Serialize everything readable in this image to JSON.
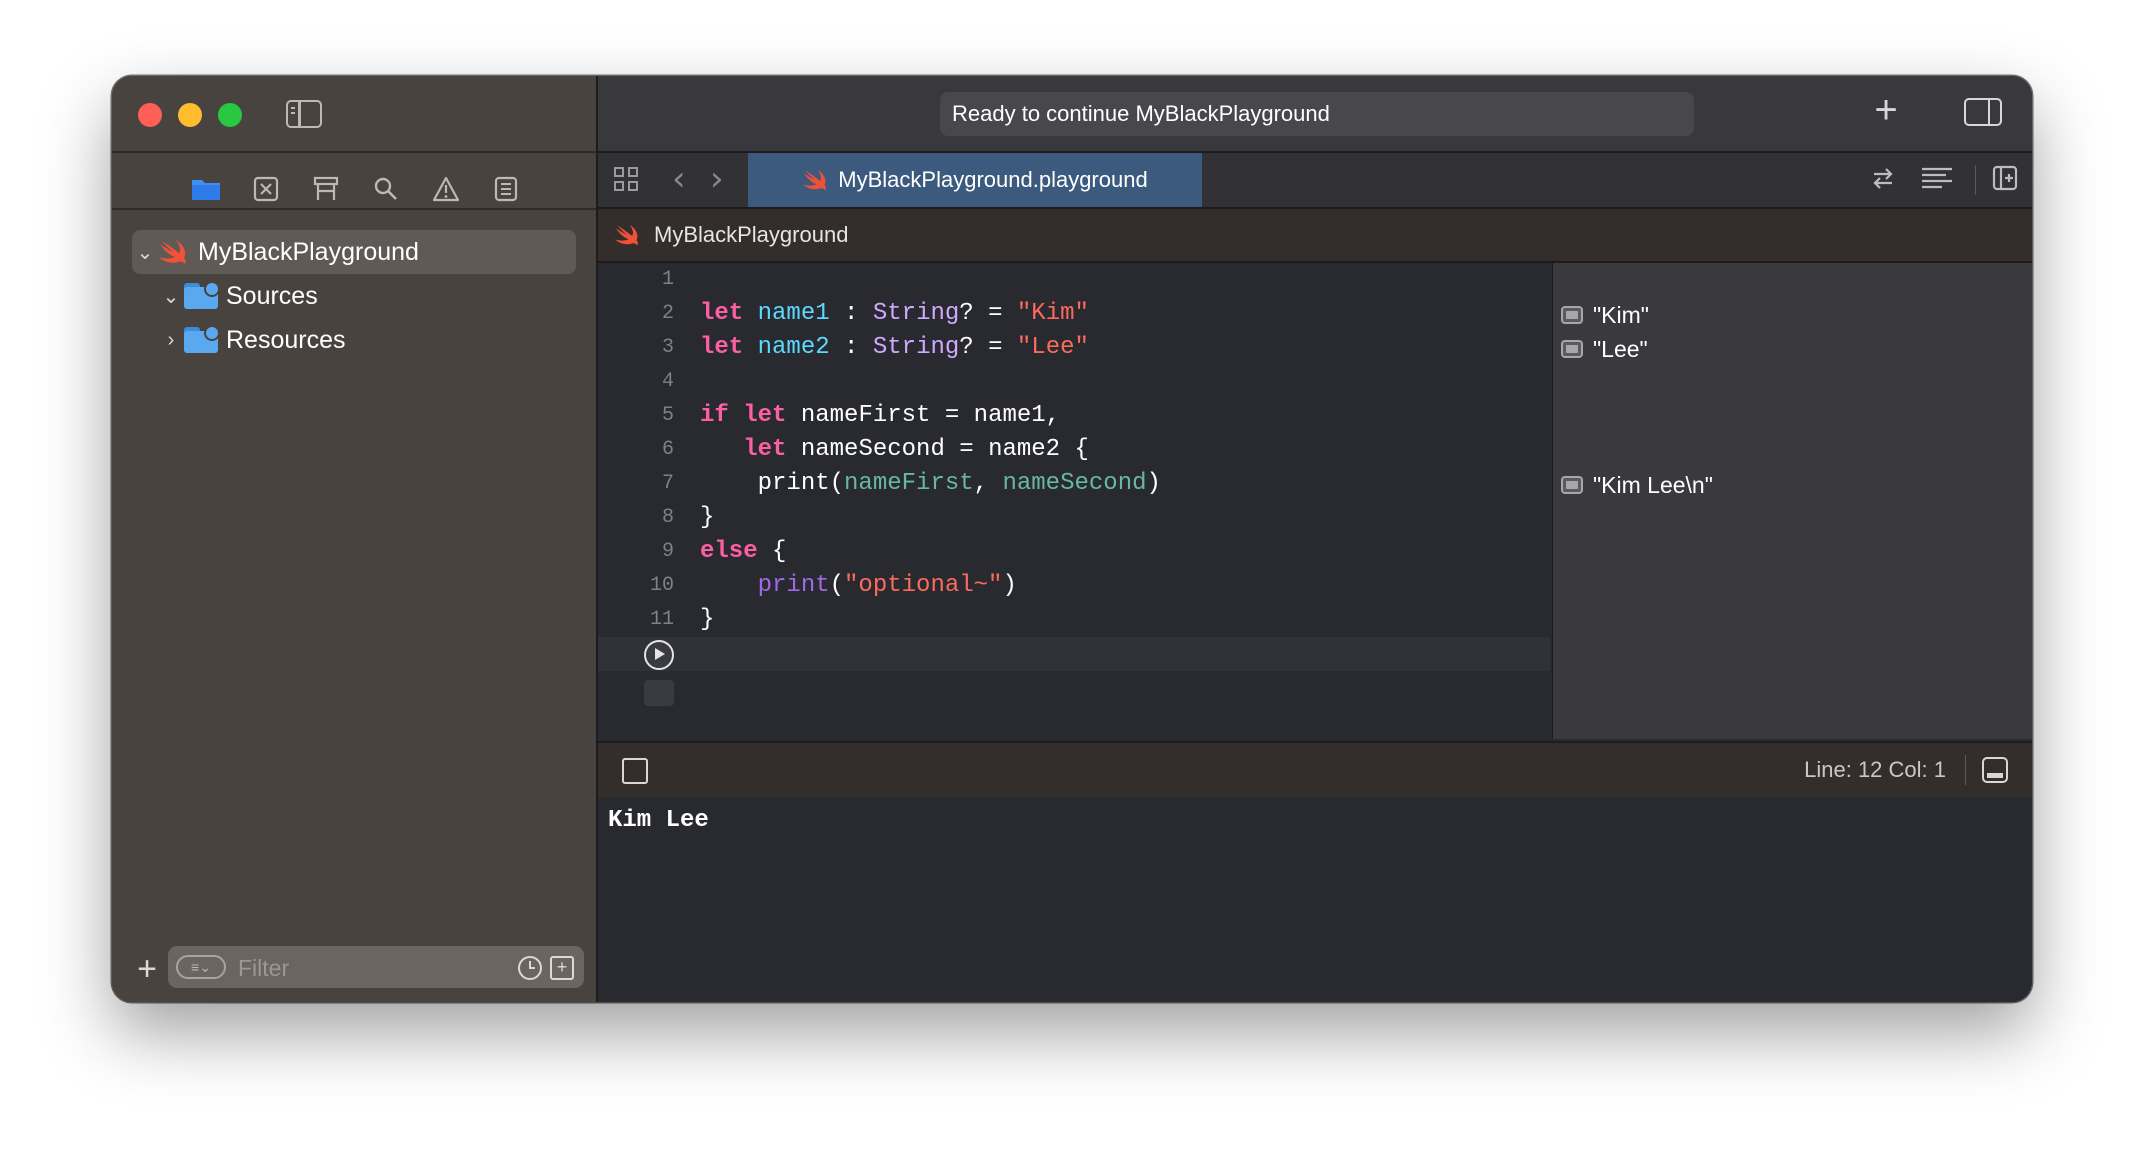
{
  "window": {
    "activity_status": "Ready to continue MyBlackPlayground"
  },
  "sidebar": {
    "tree": [
      {
        "label": "MyBlackPlayground",
        "expanded": true,
        "selected": true,
        "icon": "swift-icon"
      },
      {
        "label": "Sources",
        "expanded": true,
        "icon": "folder-icon"
      },
      {
        "label": "Resources",
        "expanded": false,
        "icon": "folder-icon"
      }
    ],
    "filter_placeholder": "Filter"
  },
  "editor": {
    "tab_label": "MyBlackPlayground.playground",
    "breadcrumb": "MyBlackPlayground",
    "lines": [
      "1",
      "2",
      "3",
      "4",
      "5",
      "6",
      "7",
      "8",
      "9",
      "10",
      "11"
    ],
    "results": [
      "\"Kim\"",
      "\"Lee\"",
      "\"Kim Lee\\n\""
    ]
  },
  "debug_bar": {
    "position": "Line: 12  Col: 1"
  },
  "console": {
    "output": "Kim Lee"
  },
  "colors": {
    "keyword": "#fc5fa3",
    "type": "#d0a8ff",
    "string": "#fc6a5d",
    "tab_selected": "#3c5a7e"
  }
}
